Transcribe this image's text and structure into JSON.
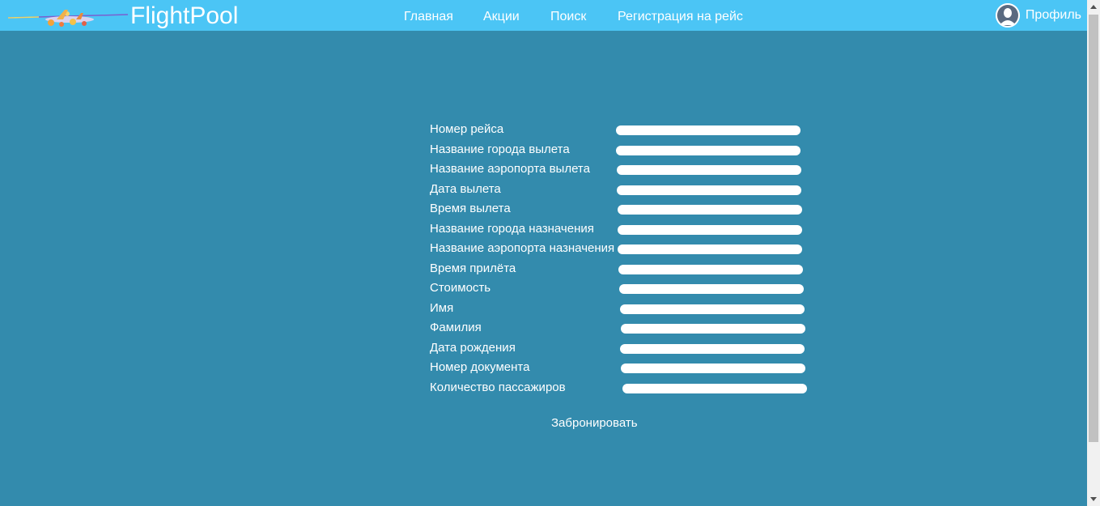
{
  "header": {
    "brand": "FlightPool",
    "nav": [
      {
        "label": "Главная"
      },
      {
        "label": "Акции"
      },
      {
        "label": "Поиск"
      },
      {
        "label": "Регистрация на рейс"
      }
    ],
    "profile_label": "Профиль"
  },
  "colors": {
    "header_bg": "#4bc5f5",
    "page_bg": "#338bad",
    "text": "#ffffff"
  },
  "form": {
    "fields": [
      {
        "label": "Номер рейса",
        "value": ""
      },
      {
        "label": "Название города вылета",
        "value": ""
      },
      {
        "label": "Название аэропорта вылета",
        "value": ""
      },
      {
        "label": "Дата вылета",
        "value": ""
      },
      {
        "label": "Время вылета",
        "value": ""
      },
      {
        "label": "Название города назначения",
        "value": ""
      },
      {
        "label": "Название аэропорта назначения",
        "value": ""
      },
      {
        "label": "Время прилёта",
        "value": ""
      },
      {
        "label": "Стоимость",
        "value": ""
      },
      {
        "label": "Имя",
        "value": ""
      },
      {
        "label": "Фамилия",
        "value": ""
      },
      {
        "label": "Дата рождения",
        "value": ""
      },
      {
        "label": "Номер документа",
        "value": ""
      },
      {
        "label": "Количество пассажиров",
        "value": ""
      }
    ],
    "submit_label": "Забронировать"
  },
  "icons": {
    "logo": "airplane-logo-icon",
    "avatar": "user-avatar-icon"
  }
}
